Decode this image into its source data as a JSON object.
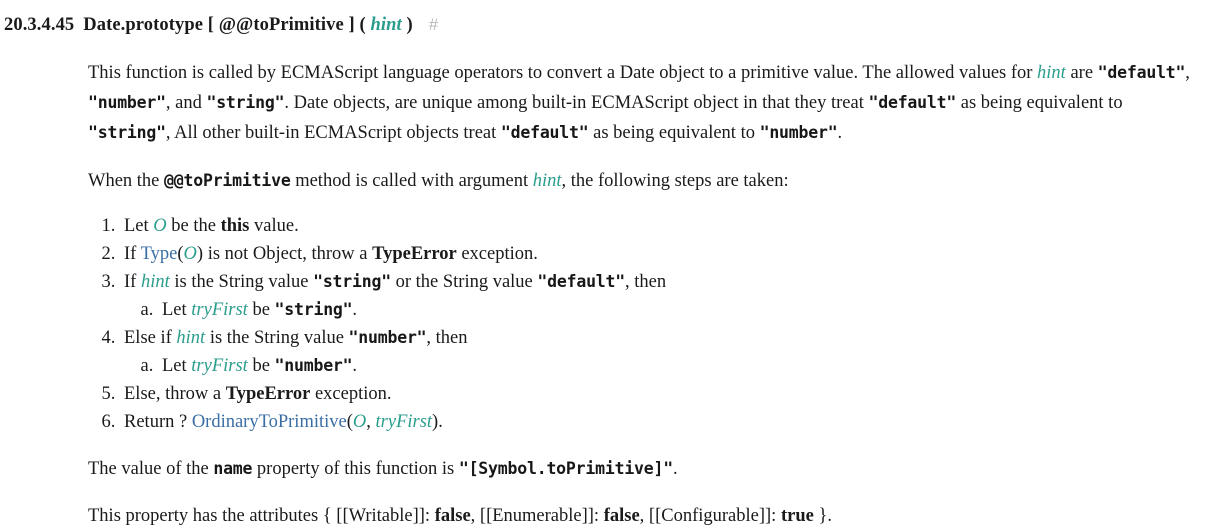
{
  "colors": {
    "text": "#1a1a1a",
    "variable_teal": "#2a9d8c",
    "link_blue": "#3a6ea5",
    "anchor_gray": "#b9b9b9",
    "background": "#ffffff"
  },
  "heading": {
    "number": "20.3.4.45",
    "title_pre": "Date.prototype [ @@toPrimitive ] ( ",
    "title_param": "hint",
    "title_post": " )",
    "anchor": "#"
  },
  "paragraphs": {
    "intro": {
      "s1": "This function is called by ECMAScript language operators to convert a Date object to a primitive value. The allowed values for ",
      "param": "hint",
      "s2": " are ",
      "code1": "\"default\"",
      "s3": ", ",
      "code2": "\"number\"",
      "s4": ", and ",
      "code3": "\"string\"",
      "s5": ". Date objects, are unique among built-in ECMAScript object in that they treat ",
      "code4": "\"default\"",
      "s6": " as being equivalent to ",
      "code5": "\"string\"",
      "s7": ", All other built-in ECMAScript objects treat ",
      "code6": "\"default\"",
      "s8": " as being equivalent to ",
      "code7": "\"number\"",
      "s9": "."
    },
    "steps_intro": {
      "s1": "When the ",
      "code1": "@@toPrimitive",
      "s2": " method is called with argument ",
      "param": "hint",
      "s3": ", the following steps are taken:"
    },
    "name_prop": {
      "s1": "The value of the ",
      "code1": "name",
      "s2": " property of this function is ",
      "code2": "\"[Symbol.toPrimitive]\"",
      "s3": "."
    },
    "attributes": {
      "s1": "This property has the attributes { [[Writable]]: ",
      "b1": "false",
      "s2": ", [[Enumerable]]: ",
      "b2": "false",
      "s3": ", [[Configurable]]: ",
      "b3": "true",
      "s4": " }."
    }
  },
  "algorithm": {
    "step1": {
      "s1": "Let ",
      "var1": "O",
      "s2": " be the ",
      "kw1": "this",
      "s3": " value."
    },
    "step2": {
      "s1": "If ",
      "link1": "Type",
      "s2": "(",
      "var1": "O",
      "s3": ") is not Object, throw a ",
      "kw1": "TypeError",
      "s4": " exception."
    },
    "step3": {
      "s1": "If ",
      "var1": "hint",
      "s2": " is the String value ",
      "code1": "\"string\"",
      "s3": " or the String value ",
      "code2": "\"default\"",
      "s4": ", then",
      "sub_a": {
        "s1": "Let ",
        "var1": "tryFirst",
        "s2": " be ",
        "code1": "\"string\"",
        "s3": "."
      }
    },
    "step4": {
      "s1": "Else if ",
      "var1": "hint",
      "s2": " is the String value ",
      "code1": "\"number\"",
      "s3": ", then",
      "sub_a": {
        "s1": "Let ",
        "var1": "tryFirst",
        "s2": " be ",
        "code1": "\"number\"",
        "s3": "."
      }
    },
    "step5": {
      "s1": "Else, throw a ",
      "kw1": "TypeError",
      "s2": " exception."
    },
    "step6": {
      "s1": "Return ? ",
      "link1": "OrdinaryToPrimitive",
      "s2": "(",
      "var1": "O",
      "s3": ", ",
      "var2": "tryFirst",
      "s4": ")."
    }
  }
}
